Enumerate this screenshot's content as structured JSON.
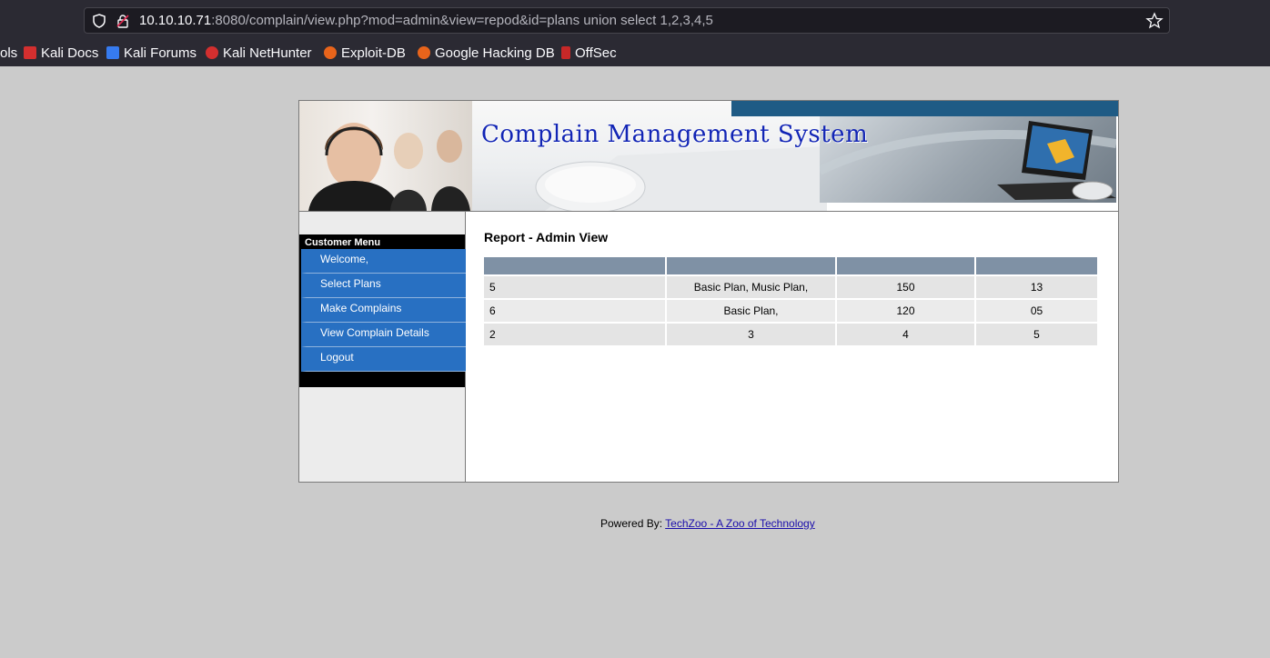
{
  "browser": {
    "url_host": "10.10.10.71",
    "url_rest": ":8080/complain/view.php?mod=admin&view=repod&id=plans union select 1,2,3,4,5",
    "bookmarks": [
      {
        "label": "ols",
        "icon": "folder-icon",
        "color": "#2b2a33"
      },
      {
        "label": "Kali Docs",
        "icon": "kali-docs-icon",
        "color": "#d32f2f"
      },
      {
        "label": "Kali Forums",
        "icon": "kali-forums-icon",
        "color": "#367bf0"
      },
      {
        "label": "Kali NetHunter",
        "icon": "kali-nethunter-icon",
        "color": "#d32f2f"
      },
      {
        "label": "Exploit-DB",
        "icon": "exploit-db-icon",
        "color": "#e8641b"
      },
      {
        "label": "Google Hacking DB",
        "icon": "ghdb-icon",
        "color": "#e8641b"
      },
      {
        "label": "OffSec",
        "icon": "offsec-icon",
        "color": "#c62828"
      }
    ]
  },
  "banner": {
    "title": "Complain Management System"
  },
  "sidebar": {
    "heading": "Customer Menu",
    "items": [
      {
        "label": "Welcome,"
      },
      {
        "label": "Select Plans"
      },
      {
        "label": "Make Complains"
      },
      {
        "label": "View Complain Details"
      },
      {
        "label": "Logout"
      }
    ]
  },
  "report": {
    "title": "Report - Admin View",
    "rows": [
      [
        "5",
        "Basic Plan, Music Plan,",
        "150",
        "13"
      ],
      [
        "6",
        "Basic Plan,",
        "120",
        "05"
      ],
      [
        "2",
        "3",
        "4",
        "5"
      ]
    ]
  },
  "footer": {
    "prefix": "Powered By: ",
    "link": "TechZoo - A Zoo of Technology"
  },
  "colors": {
    "menu_blue": "#2870c2",
    "header_gray_blue": "#7f91a5",
    "title_blue": "#1225b5"
  }
}
